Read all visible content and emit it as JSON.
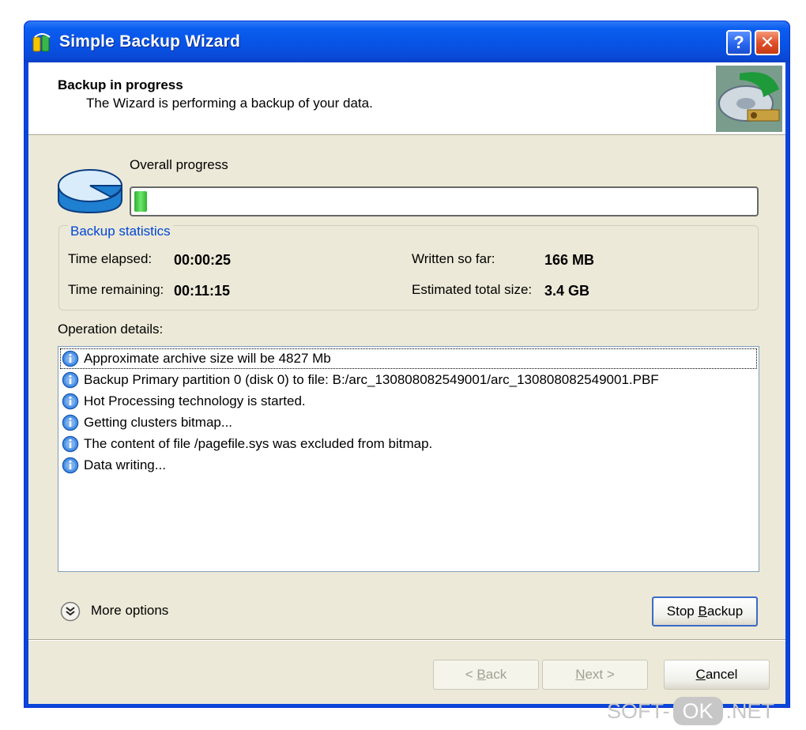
{
  "window": {
    "title": "Simple Backup Wizard",
    "help_button": "?",
    "close_button": "✕"
  },
  "header": {
    "title": "Backup in progress",
    "subtitle": "The Wizard is performing a backup of your data."
  },
  "progress": {
    "label": "Overall progress",
    "value_fraction": 0.02
  },
  "statistics": {
    "legend": "Backup statistics",
    "time_elapsed_label": "Time elapsed:",
    "time_elapsed_value": "00:00:25",
    "time_remaining_label": "Time remaining:",
    "time_remaining_value": "00:11:15",
    "written_label": "Written so far:",
    "written_value": "166 MB",
    "estimated_label": "Estimated total size:",
    "estimated_value": "3.4 GB"
  },
  "operations": {
    "label": "Operation details:",
    "items": [
      "Approximate archive size will be 4827 Mb",
      "Backup Primary partition 0 (disk 0) to file: B:/arc_130808082549001/arc_130808082549001.PBF",
      "Hot Processing technology is started.",
      "Getting clusters bitmap...",
      "The content of file /pagefile.sys was excluded from bitmap.",
      "Data writing..."
    ],
    "item_icon": "info-icon"
  },
  "more_options": {
    "label": "More options",
    "icon": "chevron-down-circle-icon"
  },
  "buttons": {
    "stop_backup_pre": "Stop ",
    "stop_backup_key": "B",
    "stop_backup_post": "ackup",
    "back_pre": "< ",
    "back_key": "B",
    "back_post": "ack",
    "next_key": "N",
    "next_post": "ext >",
    "cancel_key": "C",
    "cancel_post": "ancel"
  },
  "watermark": {
    "left": "SOFT-",
    "mid": "OK",
    "right": ".NET"
  },
  "colors": {
    "title_bar": "#0a5ef0",
    "dialog_bg": "#ece9d8",
    "progress_green": "#2fb12f",
    "legend_blue": "#0046d5"
  }
}
